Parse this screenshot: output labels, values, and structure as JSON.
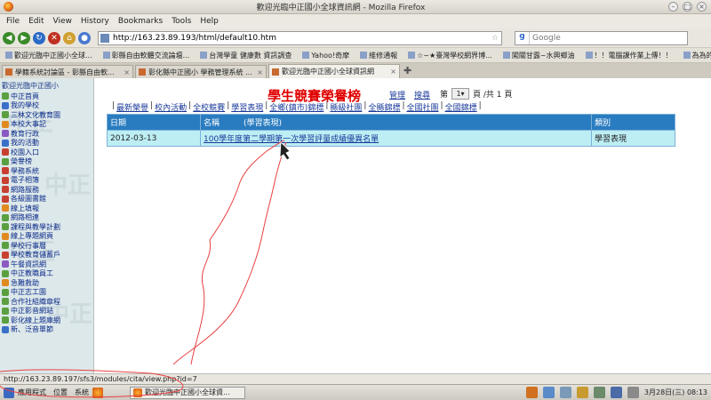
{
  "window": {
    "title": "歡迎光臨中正國小全球資訊網 - Mozilla Firefox"
  },
  "menu": [
    "File",
    "Edit",
    "View",
    "History",
    "Bookmarks",
    "Tools",
    "Help"
  ],
  "address": {
    "url": "http://163.23.89.193/html/default10.htm"
  },
  "search": {
    "placeholder": "Google"
  },
  "bookmarks": [
    "歡迎光臨中正國小全球...",
    "彰縣自由軟體交流論壇...",
    "台灣學童 健康數 資訊調查",
    "Yahoo!奇摩",
    "維修通報",
    "☆~★臺灣學校網界博...",
    "闖關甘露~水興鄉油",
    "！！電腦課作業上傳！！",
    "為為的快打高手"
  ],
  "tabs": [
    {
      "label": "學籍系統討論區 - 彰縣自由軟...",
      "active": false
    },
    {
      "label": "彰化縣中正國小 學務管理系統 ...",
      "active": false
    },
    {
      "label": "歡迎光臨中正國小全球資訊網",
      "active": true
    }
  ],
  "sidebar": {
    "header": "歡迎光臨中正國小",
    "items": [
      "中正首頁",
      "我的學校",
      "三林文化教育園",
      "本校大事記",
      "教育行政",
      "我的活動",
      "校園入口",
      "榮譽榜",
      "學務系統",
      "電子相簿",
      "網路服務",
      "各級圖書館",
      "線上填報",
      "網路相連",
      "課程與教學計劃",
      "線上專題網頁",
      "學校行事曆",
      "學校教育儲蓄戶",
      "午餐資訊網",
      "中正教職員工",
      "急難救助",
      "中正志工園",
      "合作社組織章程",
      "中正影音網站",
      "彰化線上題庫網",
      "新、泛音單節"
    ],
    "watermark": "中正"
  },
  "main": {
    "page_title": "學生競賽榮譽榜",
    "admin_link": "管理",
    "search_link": "搜尋",
    "pager_prefix": "第",
    "pager_current": "1",
    "pager_suffix": "頁 /共 1 頁",
    "categories": [
      "最新榮譽",
      "校內活動",
      "全校競賽",
      "學習表現",
      "全鄉(鎮市)錦標",
      "縣級社團",
      "全縣錦標",
      "全國社團",
      "全國錦標"
    ],
    "table": {
      "headers": [
        "日期",
        "名稱",
        "(學習表現)",
        "類別"
      ],
      "rows": [
        {
          "date": "2012-03-13",
          "name": "100學年度第二學期第一次學習評量成績優異名單",
          "category": "學習表現"
        }
      ]
    }
  },
  "status": {
    "text": "http://163.23.89.197/sfs3/modules/cita/view.php?id=7"
  },
  "taskbar": {
    "apps_label": "應用程式",
    "places_label": "位置",
    "system_label": "系統",
    "task_label": "歡迎光臨中正國小全球資...",
    "clock": "3月28日(三) 08:13"
  }
}
